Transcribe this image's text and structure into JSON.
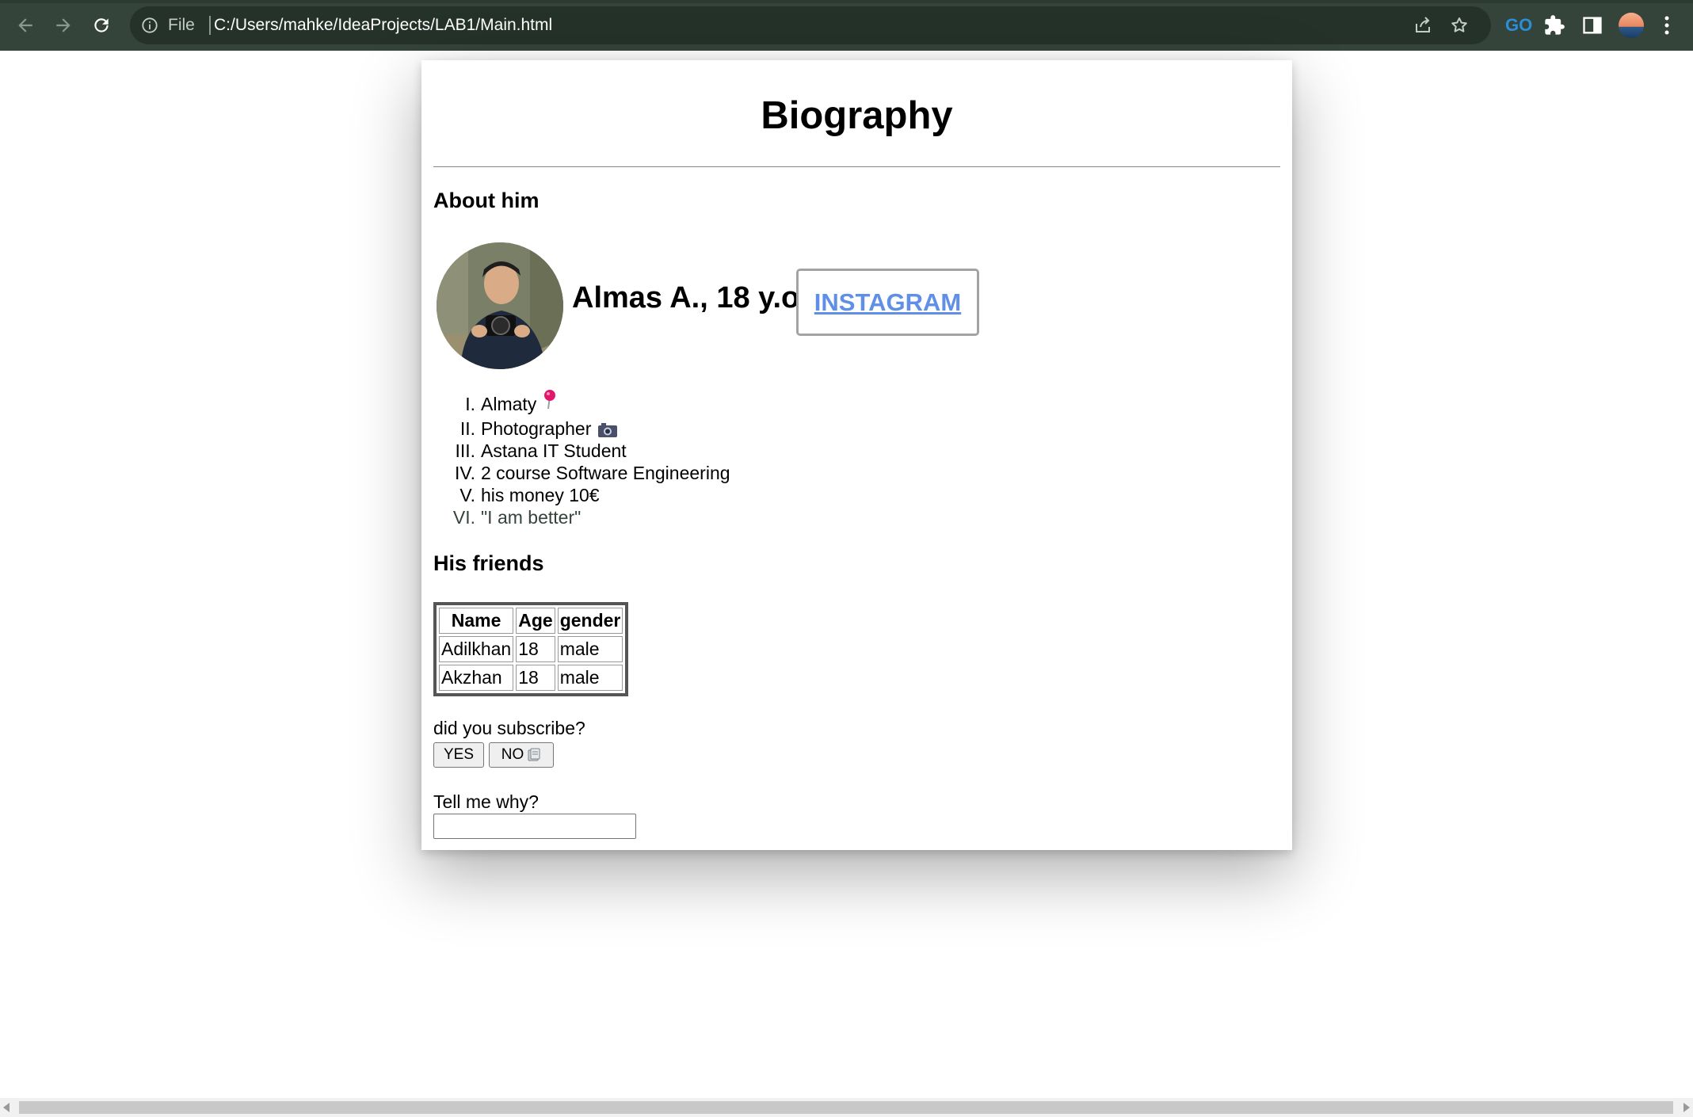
{
  "browser": {
    "scheme_label": "File",
    "url": "C:/Users/mahke/IdeaProjects/LAB1/Main.html",
    "icons": [
      "back-arrow-icon",
      "forward-arrow-icon",
      "reload-icon",
      "info-icon",
      "share-icon",
      "star-icon",
      "extension-go-icon",
      "puzzle-icon",
      "side-panel-icon",
      "avatar",
      "menu-dots-icon"
    ],
    "extension_label": "GO",
    "colors": {
      "toolbar": "#35443a",
      "omnibox": "#24322a"
    }
  },
  "page": {
    "title": "Biography",
    "about_heading": "About him",
    "name_age": "Almas A., 18 y.o",
    "instagram_label": "INSTAGRAM",
    "facts": [
      {
        "num": "I.",
        "text": "Almaty",
        "icon": "pin-icon"
      },
      {
        "num": "II.",
        "text": "Photographer",
        "icon": "camera-icon"
      },
      {
        "num": "III.",
        "text": "Astana IT Student"
      },
      {
        "num": "IV.",
        "text": "2 course Software Engineering"
      },
      {
        "num": "V.",
        "text": "his money 10€"
      },
      {
        "num": "VI.",
        "text": "\"I am better\""
      }
    ],
    "friends_heading": "His friends",
    "friends_table": {
      "headers": [
        "Name",
        "Age",
        "gender"
      ],
      "rows": [
        [
          "Adilkhan",
          "18",
          "male"
        ],
        [
          "Akzhan",
          "18",
          "male"
        ]
      ]
    },
    "subscribe_question": "did you subscribe?",
    "yes_label": "YES",
    "no_label": "NO",
    "why_label": "Tell me why?",
    "why_value": "",
    "link_color": "#5f8fe6"
  }
}
